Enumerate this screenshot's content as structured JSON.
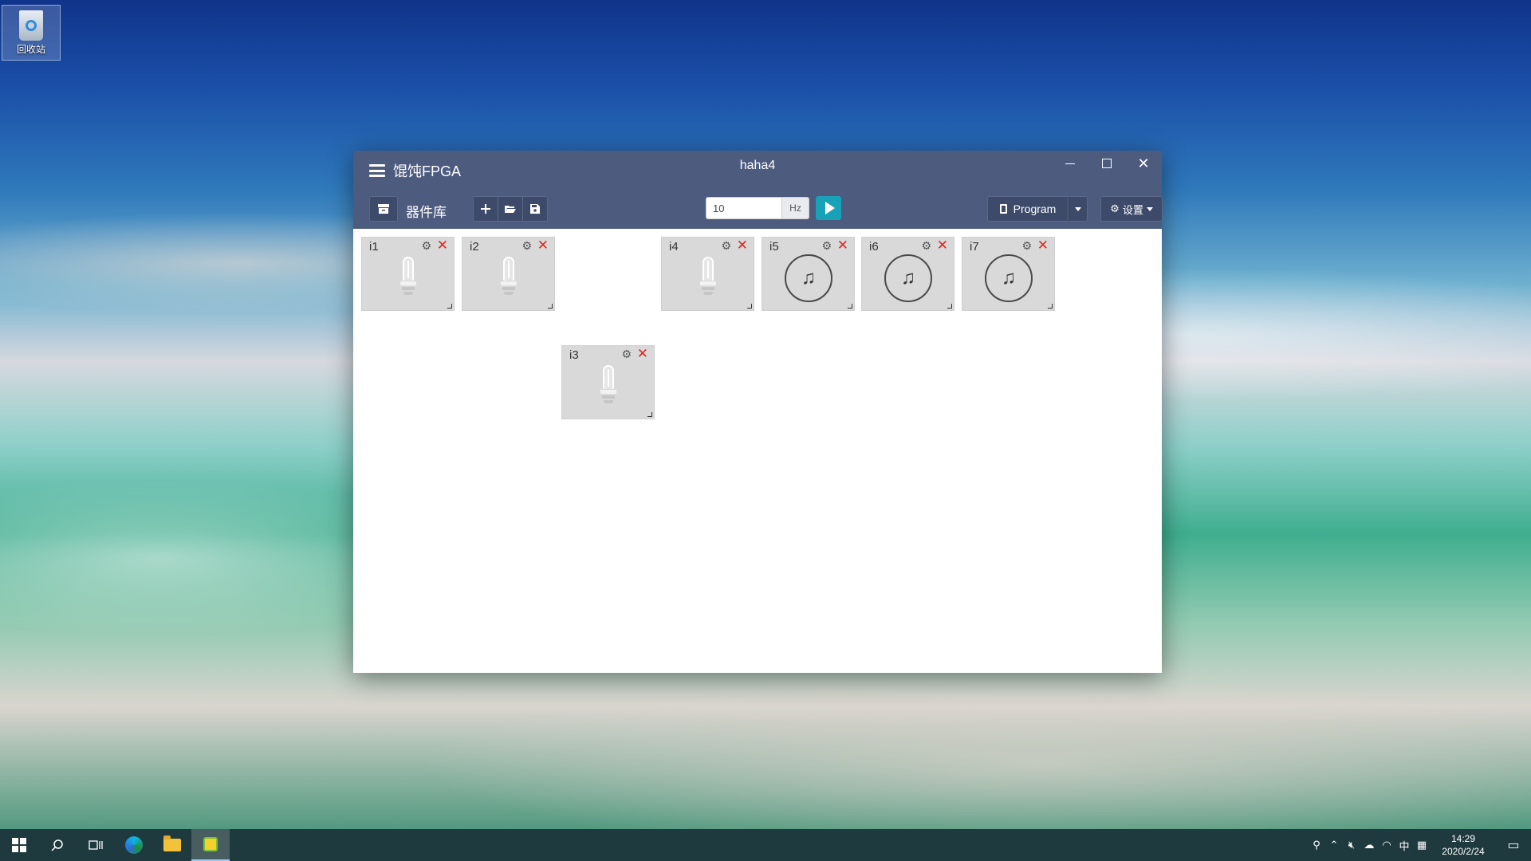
{
  "desktop": {
    "recycle_bin_label": "回收站"
  },
  "window": {
    "app_title": "馄饨FPGA",
    "document_title": "haha4",
    "controls": {
      "close": "✕"
    }
  },
  "toolbar": {
    "library_label": "器件库",
    "frequency_value": "10",
    "frequency_unit": "Hz",
    "program_label": "Program",
    "settings_label": "设置"
  },
  "devices": [
    {
      "label": "i1",
      "type": "bulb"
    },
    {
      "label": "i2",
      "type": "bulb"
    },
    {
      "label": "i3",
      "type": "bulb"
    },
    {
      "label": "i4",
      "type": "bulb"
    },
    {
      "label": "i5",
      "type": "buzzer"
    },
    {
      "label": "i6",
      "type": "buzzer"
    },
    {
      "label": "i7",
      "type": "buzzer"
    }
  ],
  "device_icons": {
    "settings": "gear-icon",
    "delete": "close-icon",
    "bulb": "light-bulb-icon",
    "buzzer": "music-note-icon"
  },
  "taskbar": {
    "time": "14:29",
    "date": "2020/2/24",
    "ime_label": "中"
  },
  "colors": {
    "titlebar": "#4d5b7f",
    "run_button": "#17a2b8",
    "delete": "#d9281f",
    "device_bg": "#d9d9d9"
  }
}
